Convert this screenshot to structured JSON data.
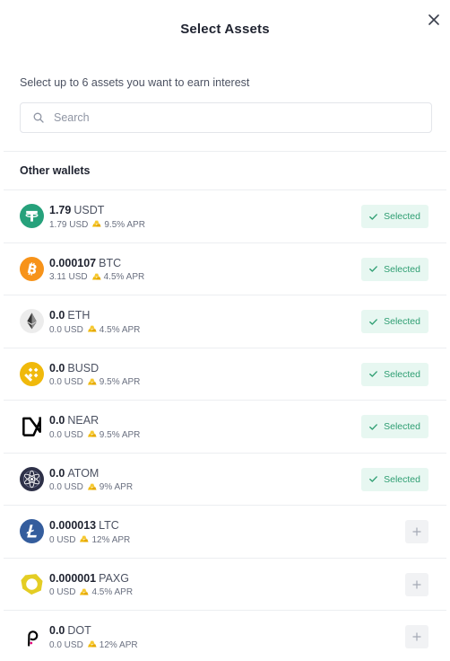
{
  "dialog": {
    "title": "Select Assets",
    "subtitle": "Select up to 6 assets you want to earn interest",
    "close_icon": "close-icon"
  },
  "search": {
    "placeholder": "Search",
    "value": ""
  },
  "section": {
    "label": "Other wallets"
  },
  "colors": {
    "accent": "#2e9e72",
    "selected_bg": "#e7f7f1",
    "gold": "#f0b90b"
  },
  "assets": [
    {
      "amount": "1.79",
      "symbol": "USDT",
      "usd": "1.79 USD",
      "apr": "9.5% APR",
      "selected": true,
      "status_label": "Selected",
      "icon": "tether-icon"
    },
    {
      "amount": "0.000107",
      "symbol": "BTC",
      "usd": "3.11 USD",
      "apr": "4.5% APR",
      "selected": true,
      "status_label": "Selected",
      "icon": "bitcoin-icon"
    },
    {
      "amount": "0.0",
      "symbol": "ETH",
      "usd": "0.0 USD",
      "apr": "4.5% APR",
      "selected": true,
      "status_label": "Selected",
      "icon": "ethereum-icon"
    },
    {
      "amount": "0.0",
      "symbol": "BUSD",
      "usd": "0.0 USD",
      "apr": "9.5% APR",
      "selected": true,
      "status_label": "Selected",
      "icon": "busd-icon"
    },
    {
      "amount": "0.0",
      "symbol": "NEAR",
      "usd": "0.0 USD",
      "apr": "9.5% APR",
      "selected": true,
      "status_label": "Selected",
      "icon": "near-icon"
    },
    {
      "amount": "0.0",
      "symbol": "ATOM",
      "usd": "0.0 USD",
      "apr": "9% APR",
      "selected": true,
      "status_label": "Selected",
      "icon": "cosmos-icon"
    },
    {
      "amount": "0.000013",
      "symbol": "LTC",
      "usd": "0 USD",
      "apr": "12% APR",
      "selected": false,
      "status_label": "",
      "icon": "litecoin-icon"
    },
    {
      "amount": "0.000001",
      "symbol": "PAXG",
      "usd": "0 USD",
      "apr": "4.5% APR",
      "selected": false,
      "status_label": "",
      "icon": "paxg-icon"
    },
    {
      "amount": "0.0",
      "symbol": "DOT",
      "usd": "0.0 USD",
      "apr": "12% APR",
      "selected": false,
      "status_label": "",
      "icon": "polkadot-icon"
    }
  ]
}
